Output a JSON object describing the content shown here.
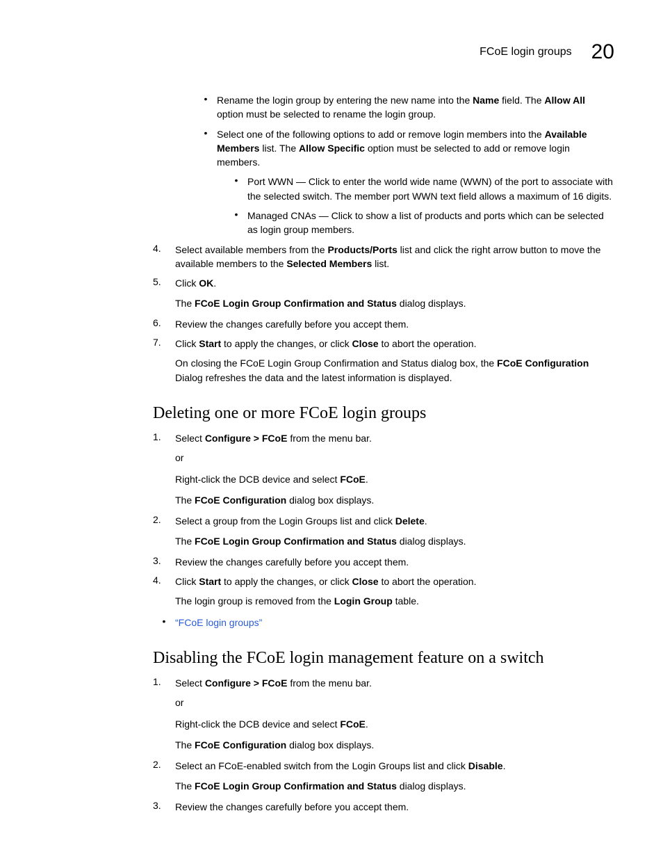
{
  "header": {
    "title": "FCoE login groups",
    "chapter": "20"
  },
  "top": {
    "b1": {
      "pre": "Rename the login group by entering the new name into the ",
      "name": "Name",
      "mid": " field. The ",
      "allow": "Allow All",
      "post": " option must be selected to rename the login group."
    },
    "b2": {
      "pre": "Select one of the following options to add or remove login members into the ",
      "avail": "Available Members",
      "mid": " list. The ",
      "spec": "Allow Specific",
      "post": " option must be selected to add or remove login members."
    },
    "b2a": "Port WWN — Click to enter the world wide name (WWN) of the port to associate with the selected switch. The member port WWN text field allows a maximum of 16 digits.",
    "b2b": "Managed CNAs — Click to show a list of products and ports which can be selected as login group members.",
    "s4": {
      "n": "4.",
      "pre": "Select available members from the ",
      "pp": "Products/Ports",
      "mid": " list and click the right arrow button to move the available members to the ",
      "sm": "Selected Members",
      "post": " list."
    },
    "s5": {
      "n": "5.",
      "pre": "Click ",
      "ok": "OK",
      "post": ".",
      "note_pre": "The ",
      "note_b": "FCoE Login Group Confirmation and Status",
      "note_post": " dialog displays."
    },
    "s6": {
      "n": "6.",
      "t": "Review the changes carefully before you accept them."
    },
    "s7": {
      "n": "7.",
      "pre": "Click ",
      "start": "Start",
      "mid": " to apply the changes, or click ",
      "close": "Close",
      "post": " to abort the operation.",
      "note_pre": "On closing the FCoE Login Group Confirmation and Status dialog box, the ",
      "note_b": "FCoE Configuration",
      "note_post": " Dialog refreshes the data and the latest information is displayed."
    }
  },
  "sec1": {
    "h": "Deleting one or more FCoE login groups",
    "s1": {
      "n": "1.",
      "pre": "Select ",
      "menu": "Configure > FCoE",
      "post": " from the menu bar.",
      "or": "or",
      "rc_pre": "Right-click the DCB device and select ",
      "rc_b": "FCoE",
      "rc_post": ".",
      "dlg_pre": "The ",
      "dlg_b": "FCoE Configuration",
      "dlg_post": " dialog box displays."
    },
    "s2": {
      "n": "2.",
      "pre": "Select a group from the Login Groups list and click ",
      "del": "Delete",
      "post": ".",
      "note_pre": "The ",
      "note_b": "FCoE Login Group Confirmation and Status",
      "note_post": " dialog displays."
    },
    "s3": {
      "n": "3.",
      "t": "Review the changes carefully before you accept them."
    },
    "s4": {
      "n": "4.",
      "pre": "Click ",
      "start": "Start",
      "mid": " to apply the changes, or click ",
      "close": "Close",
      "post": " to abort the operation.",
      "note_pre": "The login group is removed from the ",
      "note_b": "Login Group",
      "note_post": " table."
    },
    "link": "“FCoE login groups”"
  },
  "sec2": {
    "h": "Disabling the FCoE login management feature on a switch",
    "s1": {
      "n": "1.",
      "pre": "Select ",
      "menu": "Configure > FCoE",
      "post": " from the menu bar.",
      "or": "or",
      "rc_pre": "Right-click the DCB device and select ",
      "rc_b": "FCoE",
      "rc_post": ".",
      "dlg_pre": "The ",
      "dlg_b": "FCoE Configuration",
      "dlg_post": " dialog box displays."
    },
    "s2": {
      "n": "2.",
      "pre": "Select an FCoE-enabled switch from the Login Groups list and click ",
      "dis": "Disable",
      "post": ".",
      "note_pre": "The ",
      "note_b": "FCoE Login Group Confirmation and Status",
      "note_post": " dialog displays."
    },
    "s3": {
      "n": "3.",
      "t": "Review the changes carefully before you accept them."
    }
  }
}
